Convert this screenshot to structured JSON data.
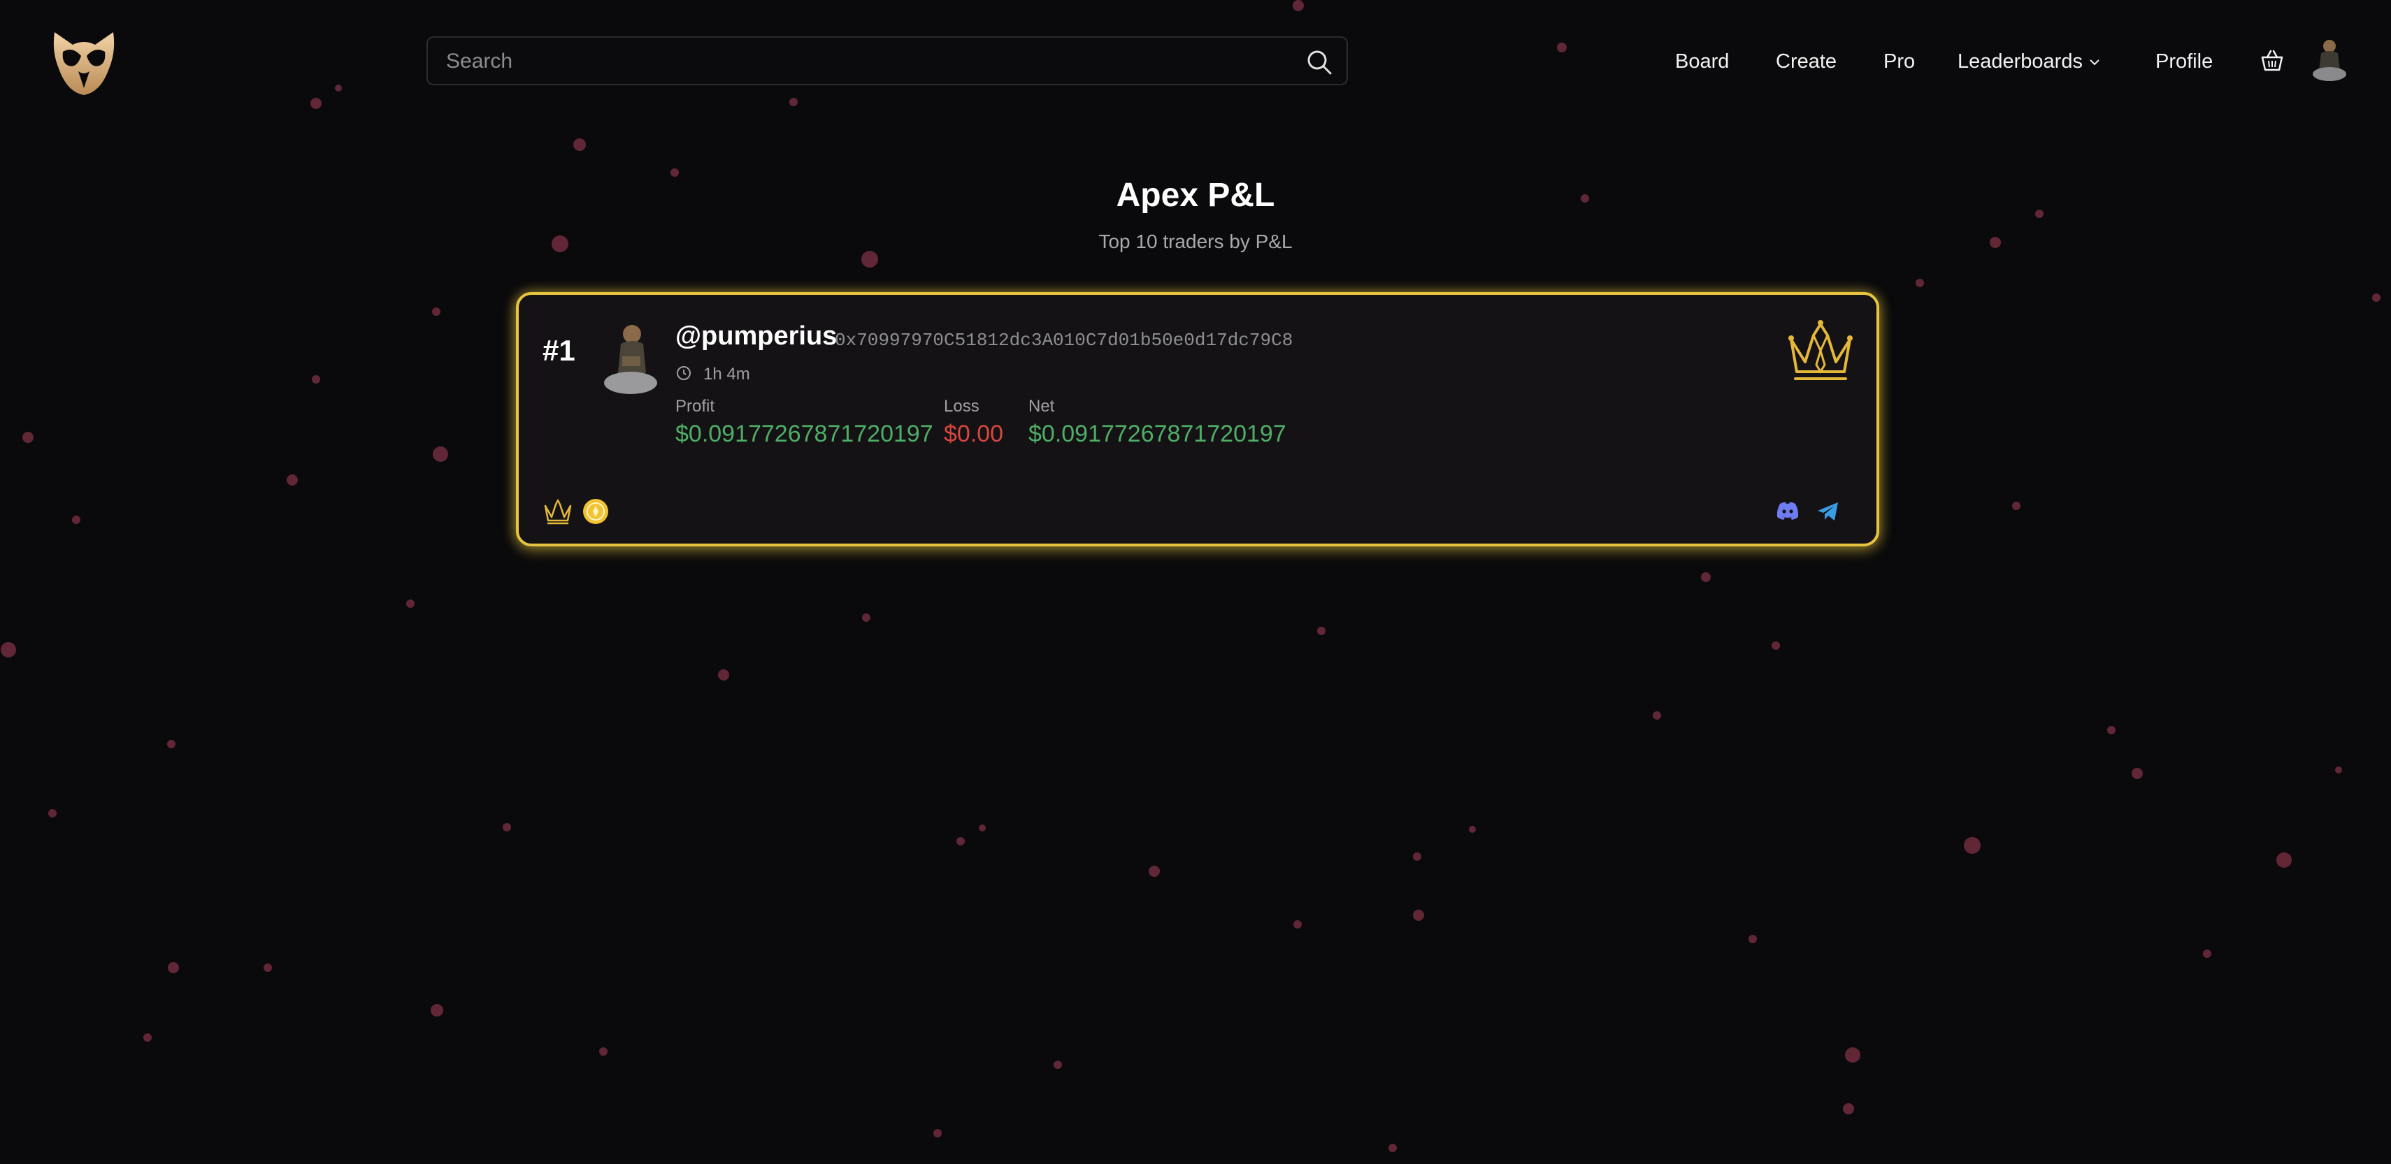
{
  "header": {
    "logo_icon": "owl-logo-icon",
    "search": {
      "placeholder": "Search",
      "value": ""
    },
    "nav": [
      {
        "label": "Board"
      },
      {
        "label": "Create"
      },
      {
        "label": "Pro"
      },
      {
        "label": "Leaderboards",
        "has_dropdown": true
      },
      {
        "label": "Profile"
      }
    ],
    "basket_icon": "basket-icon",
    "avatar_icon": "user-avatar"
  },
  "page": {
    "title": "Apex P&L",
    "subtitle": "Top 10 traders by P&L"
  },
  "leaderboard": [
    {
      "rank": "#1",
      "handle": "@pumperius",
      "address": "0x70997970C51812dc3A010C7d01b50e0d17dc79C8",
      "duration": "1h 4m",
      "profit_label": "Profit",
      "profit": "$0.09177267871720197",
      "loss_label": "Loss",
      "loss": "$0.00",
      "net_label": "Net",
      "net": "$0.09177267871720197",
      "badges": [
        "crown-icon",
        "coin-badge-icon"
      ],
      "socials": [
        "discord-icon",
        "telegram-icon"
      ]
    }
  ],
  "colors": {
    "accent_gold": "#e6c440",
    "profit_green": "#4fae66",
    "loss_red": "#d8473f",
    "particle": "#6b2a3c",
    "background": "#0a0a0c"
  }
}
